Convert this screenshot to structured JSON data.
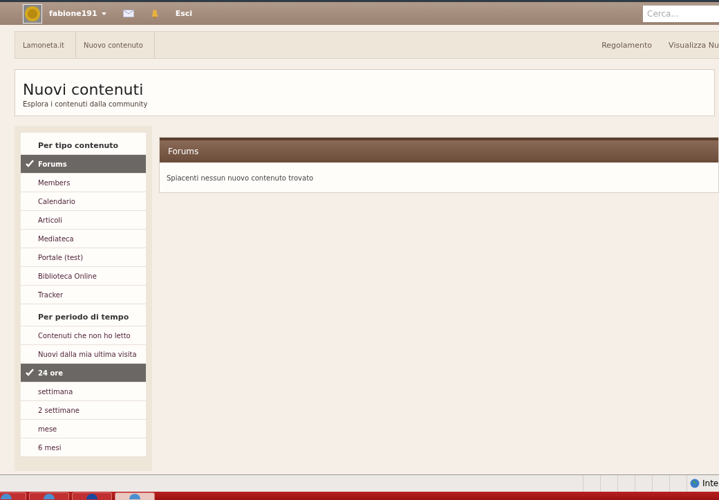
{
  "user_bar": {
    "username": "fabione191",
    "logout": "Esci",
    "search": {
      "placeholder": "Cerca..."
    }
  },
  "breadcrumb": {
    "items": [
      "Lamoneta.it",
      "Nuovo contenuto"
    ],
    "links": [
      "Regolamento",
      "Visualizza Nu"
    ]
  },
  "header": {
    "title": "Nuovi contenuti",
    "subtitle": "Esplora i contenuti dalla community"
  },
  "sidebar": {
    "sections": [
      {
        "title": "Per tipo contenuto",
        "items": [
          {
            "label": "Forums",
            "selected": true
          },
          {
            "label": "Members",
            "selected": false
          },
          {
            "label": "Calendario",
            "selected": false
          },
          {
            "label": "Articoli",
            "selected": false
          },
          {
            "label": "Mediateca",
            "selected": false
          },
          {
            "label": "Portale (test)",
            "selected": false
          },
          {
            "label": "Biblioteca Online",
            "selected": false
          },
          {
            "label": "Tracker",
            "selected": false
          }
        ]
      },
      {
        "title": "Per periodo di tempo",
        "items": [
          {
            "label": "Contenuti che non ho letto",
            "selected": false
          },
          {
            "label": "Nuovi dalla mia ultima visita",
            "selected": false
          },
          {
            "label": "24 ore",
            "selected": true
          },
          {
            "label": "settimana",
            "selected": false
          },
          {
            "label": "2 settimane",
            "selected": false
          },
          {
            "label": "mese",
            "selected": false
          },
          {
            "label": "6 mesi",
            "selected": false
          }
        ]
      }
    ]
  },
  "results": {
    "title": "Forums",
    "message": "Spiacenti nessun nuovo contenuto trovato"
  },
  "status_bar": {
    "zone": "Inte"
  },
  "taskbar": {
    "buttons": [
      {
        "selected": false
      },
      {
        "selected": false
      },
      {
        "selected": false
      },
      {
        "selected": true
      }
    ]
  }
}
